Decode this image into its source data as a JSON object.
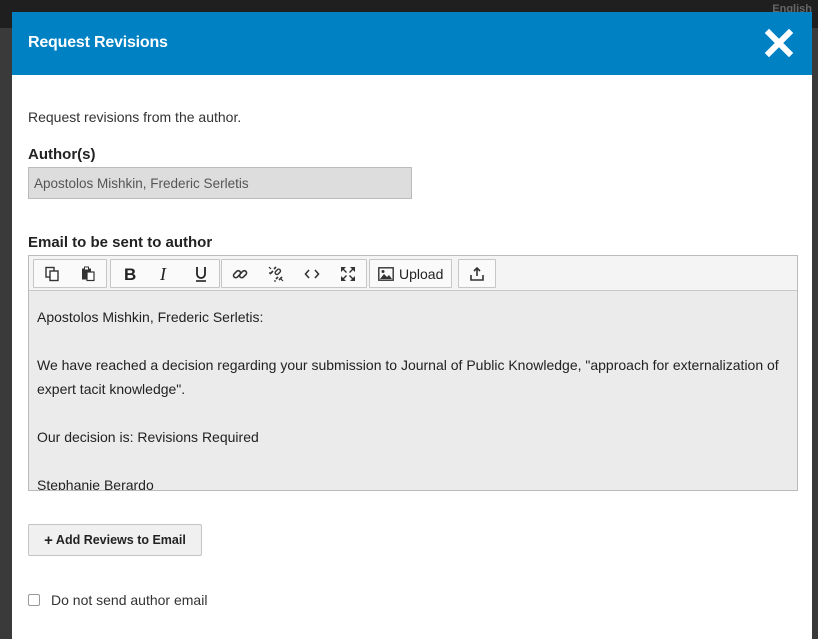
{
  "background": {
    "lang_label": "English"
  },
  "modal": {
    "title": "Request Revisions",
    "intro": "Request revisions from the author.",
    "authors_label": "Author(s)",
    "authors_value": "Apostolos Mishkin, Frederic Serletis",
    "email_label": "Email to be sent to author",
    "toolbar": {
      "buttons": [
        "copy-icon",
        "paste-icon",
        "bold-icon",
        "italic-icon",
        "underline-icon",
        "link-icon",
        "unlink-icon",
        "code-icon",
        "fullscreen-icon",
        "image-icon",
        "insert-icon"
      ],
      "upload_label": "Upload"
    },
    "email_body": {
      "greeting": "Apostolos Mishkin, Frederic Serletis:",
      "paragraph": "We have reached a decision regarding your submission to Journal of Public Knowledge, \"approach for externalization of expert tacit knowledge\".",
      "decision": "Our decision is: Revisions Required",
      "signature": "Stephanie Berardo"
    },
    "add_reviews_label": "Add Reviews to Email",
    "no_email_label": "Do not send author email"
  },
  "colors": {
    "header": "#0081c3",
    "editor_bg": "#ebebeb"
  }
}
